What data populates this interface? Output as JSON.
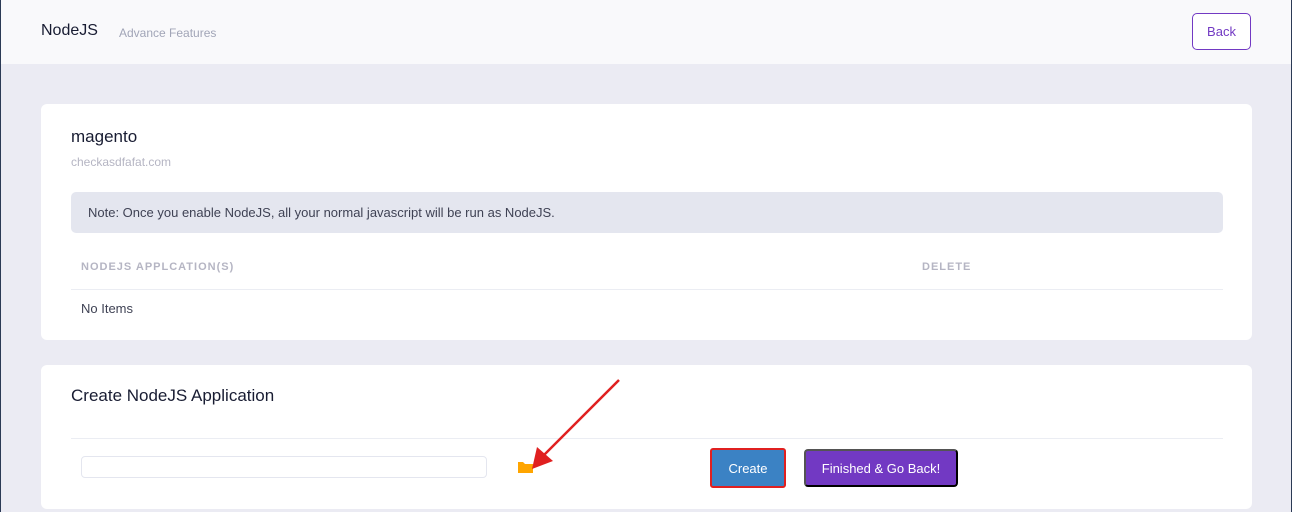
{
  "header": {
    "title": "NodeJS",
    "subtitle": "Advance Features",
    "back_label": "Back"
  },
  "site": {
    "name": "magento",
    "domain": "checkasdfafat.com"
  },
  "note": "Note: Once you enable NodeJS, all your normal javascript will be run as NodeJS.",
  "table": {
    "columns": [
      "NODEJS APPLCATION(S)",
      "DELETE"
    ],
    "empty_text": "No Items"
  },
  "create": {
    "title": "Create NodeJS Application",
    "input_value": "",
    "create_label": "Create",
    "finish_label": "Finished & Go Back!"
  },
  "colors": {
    "accent": "#7239c3",
    "create_button": "#3b82c4",
    "highlight": "#e02020",
    "folder": "#ffa500"
  },
  "icons": {
    "folder": "folder-icon"
  }
}
